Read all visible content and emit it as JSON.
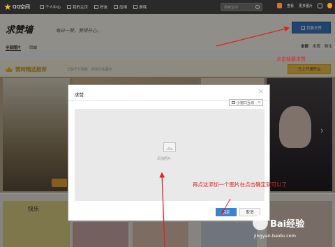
{
  "topbar": {
    "brand": "QQ空间",
    "nav": [
      {
        "label": "个人中心",
        "icon": "user-icon"
      },
      {
        "label": "我的主页",
        "icon": "home-icon"
      },
      {
        "label": "好友",
        "icon": "friends-icon"
      },
      {
        "label": "应用",
        "icon": "apps-icon"
      },
      {
        "label": "游戏",
        "icon": "game-icon"
      }
    ],
    "search_placeholder": "搜索空间",
    "right": [
      "查看",
      "更多图片"
    ]
  },
  "header": {
    "brand": "求赞墙",
    "slogan": "每日一赞，赞得开心。",
    "publish_label": "我要求赞",
    "tabs": [
      "全部图片",
      "同城"
    ],
    "sort_tabs": [
      "全部",
      "本周",
      "新生"
    ]
  },
  "featured": {
    "title": "赞转精选推荐",
    "subtitle": "已获千万赞数 · 即可优先展示",
    "join_label": "马上开通赞站"
  },
  "modal": {
    "title": "求赞",
    "small_window_label": "小窗口互动",
    "upload_label": "添加照片",
    "ok_label": "确定",
    "cancel_label": "取消"
  },
  "strip": {
    "caption": "快乐"
  },
  "annotations": {
    "note_top": "点击我要求赞",
    "note_bottom": "再点这添加一个图片在点击确定就可以了",
    "color": "#e02222"
  },
  "watermark": {
    "brand": "Bai经验",
    "url": "jingyan.baidu.com"
  }
}
